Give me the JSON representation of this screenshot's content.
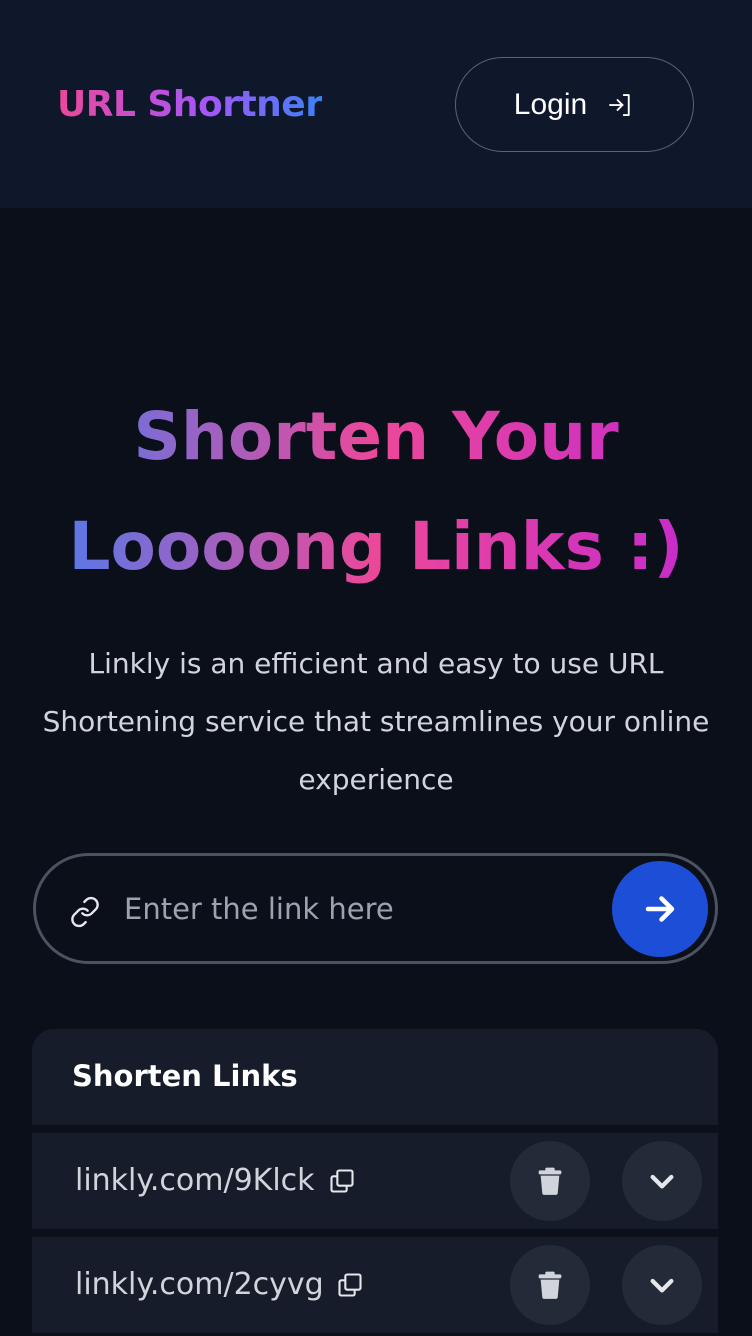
{
  "header": {
    "brand": "URL Shortner",
    "login_label": "Login",
    "login_icon": "sign-in-icon"
  },
  "hero": {
    "title_line1": "Shorten Your",
    "title_line2": "Loooong Links :)",
    "description": "Linkly is an efficient and easy to use URL Shortening service that streamlines your online experience"
  },
  "shorten_form": {
    "value": "",
    "placeholder": "Enter the link here",
    "input_icon": "link-icon",
    "submit_icon": "arrow-right-icon"
  },
  "links_panel": {
    "title": "Shorten Links",
    "items": [
      {
        "short_url": "linkly.com/9Klck",
        "copy_icon": "copy-icon",
        "delete_icon": "trash-icon",
        "expand_icon": "chevron-down-icon"
      },
      {
        "short_url": "linkly.com/2cyvg",
        "copy_icon": "copy-icon",
        "delete_icon": "trash-icon",
        "expand_icon": "chevron-down-icon"
      }
    ]
  },
  "colors": {
    "background": "#0b0f1a",
    "header_bg": "#0f172a",
    "panel_bg": "#161c2a",
    "accent_blue": "#1d4ed8",
    "gradient_pink": "#ec4899",
    "gradient_purple": "#a855f7",
    "gradient_blue": "#3b82f6"
  }
}
